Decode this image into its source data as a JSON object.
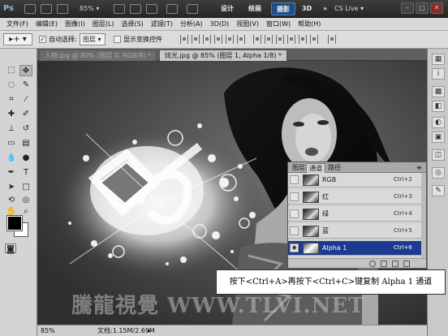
{
  "titlebar": {
    "logo": "Ps",
    "zoom": "85%",
    "workspaces": [
      "设计",
      "绘画",
      "摄影",
      "3D"
    ],
    "active_workspace": "摄影",
    "more": "»",
    "cs_live": "CS Live ▾",
    "window_controls": [
      "–",
      "□",
      "✕"
    ]
  },
  "menubar": {
    "items": [
      "文件(F)",
      "编辑(E)",
      "图像(I)",
      "图层(L)",
      "选择(S)",
      "滤镜(T)",
      "分析(A)",
      "3D(D)",
      "视图(V)",
      "窗口(W)",
      "帮助(H)"
    ]
  },
  "options": {
    "auto_select_label": "自动选择:",
    "auto_select_checked": true,
    "auto_select_target": "图层",
    "show_transform_label": "显示变换控件",
    "show_transform_checked": false
  },
  "tabs": [
    {
      "label": "人物.jpg @ 80% (图层 0, RGB/8) *",
      "active": false
    },
    {
      "label": "炫光.jpg @ 85% (图层 1, Alpha 1/8) *",
      "active": true
    }
  ],
  "channels_panel": {
    "tabs": [
      "图层",
      "通道",
      "路径"
    ],
    "active_tab": "通道",
    "rows": [
      {
        "name": "RGB",
        "shortcut": "Ctrl+2",
        "visible": false,
        "selected": false
      },
      {
        "name": "红",
        "shortcut": "Ctrl+3",
        "visible": false,
        "selected": false
      },
      {
        "name": "绿",
        "shortcut": "Ctrl+4",
        "visible": false,
        "selected": false
      },
      {
        "name": "蓝",
        "shortcut": "Ctrl+5",
        "visible": false,
        "selected": false
      },
      {
        "name": "Alpha 1",
        "shortcut": "Ctrl+6",
        "visible": true,
        "selected": true
      }
    ]
  },
  "status": {
    "zoom": "85%",
    "doc_info": "文档:1.15M/2.69M"
  },
  "caption": "按下<Ctrl+A>再按下<Ctrl+C>键复制 Alpha 1 通道",
  "watermark": "騰龍視覺 WWW.TLVI.NET",
  "colors": {
    "selected_row": "#1c3a8f",
    "active_workspace": "#1f4d86",
    "foreground": "#000000",
    "background": "#ffffff"
  }
}
